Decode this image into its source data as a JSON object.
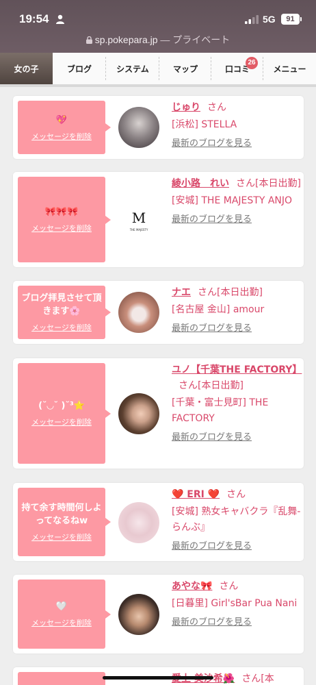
{
  "status": {
    "time": "19:54",
    "network": "5G",
    "battery": "91",
    "url": "sp.pokepara.jp",
    "url_suffix": " — プライベート"
  },
  "nav": [
    {
      "label": "女の子",
      "badge": ""
    },
    {
      "label": "ブログ",
      "badge": ""
    },
    {
      "label": "システム",
      "badge": ""
    },
    {
      "label": "マップ",
      "badge": ""
    },
    {
      "label": "口コミ",
      "badge": "26"
    },
    {
      "label": "メニュー",
      "badge": ""
    }
  ],
  "cards": [
    {
      "message": "💖",
      "delete_label": "メッセージを削除",
      "name": "じゅり",
      "san": "さん",
      "shop": "[浜松] STELLA",
      "blog": "最新のブログを見る"
    },
    {
      "message": "🎀🎀🎀",
      "delete_label": "メッセージを削除",
      "name": "綾小路　れい",
      "san": "さん[本日出勤]",
      "shop": "[安城] THE MAJESTY ANJO",
      "blog": "最新のブログを見る"
    },
    {
      "message": "ブログ拝見させて頂きます🌸",
      "delete_label": "メッセージを削除",
      "name": "ナエ",
      "san": "さん[本日出勤]",
      "shop": "[名古屋 金山] amour",
      "blog": "最新のブログを見る"
    },
    {
      "message": "(˘◡˘ )˘³⭐️",
      "delete_label": "メッセージを削除",
      "name": "ユノ【千葉THE FACTORY】",
      "san": "さん[本日出勤]",
      "shop": "[千葉・富士見町] THE FACTORY",
      "blog": "最新のブログを見る"
    },
    {
      "message": "持て余す時間何しよってなるねw",
      "delete_label": "メッセージを削除",
      "name": "❤️ ERI ❤️",
      "san": "さん",
      "shop": "[安城] 熟女キャバクラ『乱舞-らんぶ』",
      "blog": "最新のブログを見る"
    },
    {
      "message": "🤍",
      "delete_label": "メッセージを削除",
      "name": "あやな🎀",
      "san": "さん",
      "shop": "[日暮里] Girl'sBar Pua Nani",
      "blog": "最新のブログを見る"
    },
    {
      "message": "",
      "delete_label": "",
      "name": "愛上 美沙希🌺",
      "san": "さん[本",
      "shop": "",
      "blog": ""
    }
  ],
  "logo_text": "THE MAJESTY",
  "colors": {
    "accent": "#d9486a",
    "bubble": "#fd99a3",
    "badge": "#e25c66"
  }
}
